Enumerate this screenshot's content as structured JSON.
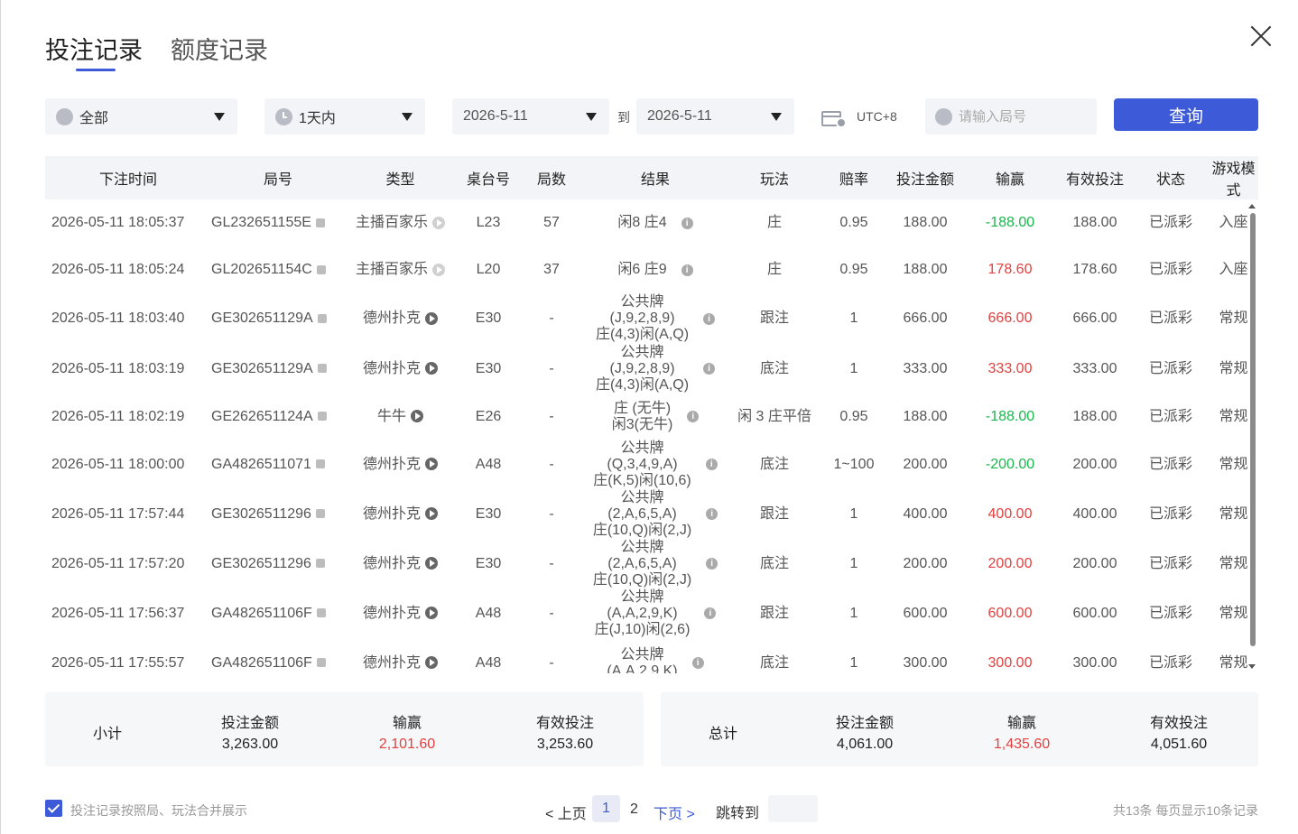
{
  "tabs": [
    {
      "label": "投注记录",
      "active": true
    },
    {
      "label": "额度记录",
      "active": false
    }
  ],
  "filters": {
    "game_type": "全部",
    "range": "1天内",
    "date_from": "2026-5-11",
    "to_label": "到",
    "date_to": "2026-5-11",
    "timezone": "UTC+8",
    "round_placeholder": "请输入局号",
    "query_button": "查询"
  },
  "table": {
    "columns": [
      "下注时间",
      "局号",
      "类型",
      "桌台号",
      "局数",
      "结果",
      "玩法",
      "赔率",
      "投注金额",
      "输赢",
      "有效投注",
      "状态",
      "游戏模式"
    ],
    "rows": [
      {
        "time": "2026-05-11 18:05:37",
        "round_id": "GL232651155E",
        "type": "主播百家乐",
        "table": "L23",
        "count": "57",
        "result": [
          "闲8 庄4"
        ],
        "play": "庄",
        "odds": "0.95",
        "bet": "188.00",
        "win": "-188.00",
        "win_sign": "neg",
        "valid": "188.00",
        "status": "已派彩",
        "mode": "入座"
      },
      {
        "time": "2026-05-11 18:05:24",
        "round_id": "GL202651154C",
        "type": "主播百家乐",
        "table": "L20",
        "count": "37",
        "result": [
          "闲6 庄9"
        ],
        "play": "庄",
        "odds": "0.95",
        "bet": "188.00",
        "win": "178.60",
        "win_sign": "pos",
        "valid": "178.60",
        "status": "已派彩",
        "mode": "入座"
      },
      {
        "time": "2026-05-11 18:03:40",
        "round_id": "GE302651129A",
        "type": "德州扑克",
        "table": "E30",
        "count": "-",
        "result": [
          "公共牌",
          "(J,9,2,8,9)",
          "庄(4,3)闲(A,Q)"
        ],
        "play": "跟注",
        "odds": "1",
        "bet": "666.00",
        "win": "666.00",
        "win_sign": "pos",
        "valid": "666.00",
        "status": "已派彩",
        "mode": "常规"
      },
      {
        "time": "2026-05-11 18:03:19",
        "round_id": "GE302651129A",
        "type": "德州扑克",
        "table": "E30",
        "count": "-",
        "result": [
          "公共牌",
          "(J,9,2,8,9)",
          "庄(4,3)闲(A,Q)"
        ],
        "play": "底注",
        "odds": "1",
        "bet": "333.00",
        "win": "333.00",
        "win_sign": "pos",
        "valid": "333.00",
        "status": "已派彩",
        "mode": "常规"
      },
      {
        "time": "2026-05-11 18:02:19",
        "round_id": "GE262651124A",
        "type": "牛牛",
        "table": "E26",
        "count": "-",
        "result": [
          "庄 (无牛)",
          "闲3(无牛)"
        ],
        "play": "闲 3 庄平倍",
        "odds": "0.95",
        "bet": "188.00",
        "win": "-188.00",
        "win_sign": "neg",
        "valid": "188.00",
        "status": "已派彩",
        "mode": "常规"
      },
      {
        "time": "2026-05-11 18:00:00",
        "round_id": "GA4826511071",
        "type": "德州扑克",
        "table": "A48",
        "count": "-",
        "result": [
          "公共牌",
          "(Q,3,4,9,A)",
          "庄(K,5)闲(10,6)"
        ],
        "play": "底注",
        "odds": "1~100",
        "bet": "200.00",
        "win": "-200.00",
        "win_sign": "neg",
        "valid": "200.00",
        "status": "已派彩",
        "mode": "常规"
      },
      {
        "time": "2026-05-11 17:57:44",
        "round_id": "GE3026511296",
        "type": "德州扑克",
        "table": "E30",
        "count": "-",
        "result": [
          "公共牌",
          "(2,A,6,5,A)",
          "庄(10,Q)闲(2,J)"
        ],
        "play": "跟注",
        "odds": "1",
        "bet": "400.00",
        "win": "400.00",
        "win_sign": "pos",
        "valid": "400.00",
        "status": "已派彩",
        "mode": "常规"
      },
      {
        "time": "2026-05-11 17:57:20",
        "round_id": "GE3026511296",
        "type": "德州扑克",
        "table": "E30",
        "count": "-",
        "result": [
          "公共牌",
          "(2,A,6,5,A)",
          "庄(10,Q)闲(2,J)"
        ],
        "play": "底注",
        "odds": "1",
        "bet": "200.00",
        "win": "200.00",
        "win_sign": "pos",
        "valid": "200.00",
        "status": "已派彩",
        "mode": "常规"
      },
      {
        "time": "2026-05-11 17:56:37",
        "round_id": "GA482651106F",
        "type": "德州扑克",
        "table": "A48",
        "count": "-",
        "result": [
          "公共牌",
          "(A,A,2,9,K)",
          "庄(J,10)闲(2,6)"
        ],
        "play": "跟注",
        "odds": "1",
        "bet": "600.00",
        "win": "600.00",
        "win_sign": "pos",
        "valid": "600.00",
        "status": "已派彩",
        "mode": "常规"
      },
      {
        "time": "2026-05-11 17:55:57",
        "round_id": "GA482651106F",
        "type": "德州扑克",
        "table": "A48",
        "count": "-",
        "result": [
          "公共牌",
          "(A,A,2,9,K)"
        ],
        "play": "底注",
        "odds": "1",
        "bet": "300.00",
        "win": "300.00",
        "win_sign": "pos",
        "valid": "300.00",
        "status": "已派彩",
        "mode": "常规"
      }
    ]
  },
  "subtotal": {
    "label": "小计",
    "bet_label": "投注金额",
    "bet": "3,263.00",
    "win_label": "输赢",
    "win": "2,101.60",
    "valid_label": "有效投注",
    "valid": "3,253.60"
  },
  "total": {
    "label": "总计",
    "bet_label": "投注金额",
    "bet": "4,061.00",
    "win_label": "输赢",
    "win": "1,435.60",
    "valid_label": "有效投注",
    "valid": "4,051.60"
  },
  "footer": {
    "merge_label": "投注记录按照局、玩法合并展示",
    "prev": "< 上页",
    "page1": "1",
    "page2": "2",
    "next": "下页 >",
    "jump_label": "跳转到",
    "info": "共13条   每页显示10条记录"
  },
  "colors": {
    "accent": "#3d5bd9",
    "win": "#e34040",
    "loss": "#19b84c"
  }
}
